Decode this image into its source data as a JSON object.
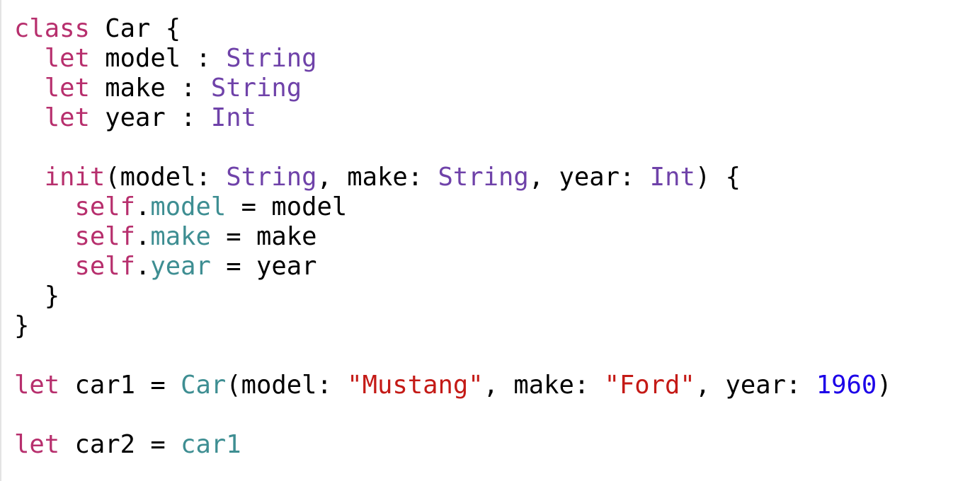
{
  "colors": {
    "keyword": "#b72f6d",
    "type": "#6f42a9",
    "property": "#3e8e92",
    "string": "#c41a16",
    "number": "#1c00e8",
    "plain": "#000000",
    "background": "#ffffff"
  },
  "lines": [
    [
      {
        "t": "class",
        "c": "kw"
      },
      {
        "t": " Car {",
        "c": "plain"
      }
    ],
    [
      {
        "t": "  ",
        "c": "plain"
      },
      {
        "t": "let",
        "c": "kw"
      },
      {
        "t": " model : ",
        "c": "plain"
      },
      {
        "t": "String",
        "c": "type"
      }
    ],
    [
      {
        "t": "  ",
        "c": "plain"
      },
      {
        "t": "let",
        "c": "kw"
      },
      {
        "t": " make : ",
        "c": "plain"
      },
      {
        "t": "String",
        "c": "type"
      }
    ],
    [
      {
        "t": "  ",
        "c": "plain"
      },
      {
        "t": "let",
        "c": "kw"
      },
      {
        "t": " year : ",
        "c": "plain"
      },
      {
        "t": "Int",
        "c": "type"
      }
    ],
    [],
    [
      {
        "t": "  ",
        "c": "plain"
      },
      {
        "t": "init",
        "c": "kw"
      },
      {
        "t": "(model: ",
        "c": "plain"
      },
      {
        "t": "String",
        "c": "type"
      },
      {
        "t": ", make: ",
        "c": "plain"
      },
      {
        "t": "String",
        "c": "type"
      },
      {
        "t": ", year: ",
        "c": "plain"
      },
      {
        "t": "Int",
        "c": "type"
      },
      {
        "t": ") {",
        "c": "plain"
      }
    ],
    [
      {
        "t": "    ",
        "c": "plain"
      },
      {
        "t": "self",
        "c": "kw"
      },
      {
        "t": ".",
        "c": "plain"
      },
      {
        "t": "model",
        "c": "prop"
      },
      {
        "t": " = model",
        "c": "plain"
      }
    ],
    [
      {
        "t": "    ",
        "c": "plain"
      },
      {
        "t": "self",
        "c": "kw"
      },
      {
        "t": ".",
        "c": "plain"
      },
      {
        "t": "make",
        "c": "prop"
      },
      {
        "t": " = make",
        "c": "plain"
      }
    ],
    [
      {
        "t": "    ",
        "c": "plain"
      },
      {
        "t": "self",
        "c": "kw"
      },
      {
        "t": ".",
        "c": "plain"
      },
      {
        "t": "year",
        "c": "prop"
      },
      {
        "t": " = year",
        "c": "plain"
      }
    ],
    [
      {
        "t": "  }",
        "c": "plain"
      }
    ],
    [
      {
        "t": "}",
        "c": "plain"
      }
    ],
    [],
    [
      {
        "t": "let",
        "c": "kw"
      },
      {
        "t": " car1 = ",
        "c": "plain"
      },
      {
        "t": "Car",
        "c": "prop"
      },
      {
        "t": "(model: ",
        "c": "plain"
      },
      {
        "t": "\"Mustang\"",
        "c": "str"
      },
      {
        "t": ", make: ",
        "c": "plain"
      },
      {
        "t": "\"Ford\"",
        "c": "str"
      },
      {
        "t": ", year: ",
        "c": "plain"
      },
      {
        "t": "1960",
        "c": "num"
      },
      {
        "t": ")",
        "c": "plain"
      }
    ],
    [],
    [
      {
        "t": "let",
        "c": "kw"
      },
      {
        "t": " car2 = ",
        "c": "plain"
      },
      {
        "t": "car1",
        "c": "prop"
      }
    ]
  ]
}
